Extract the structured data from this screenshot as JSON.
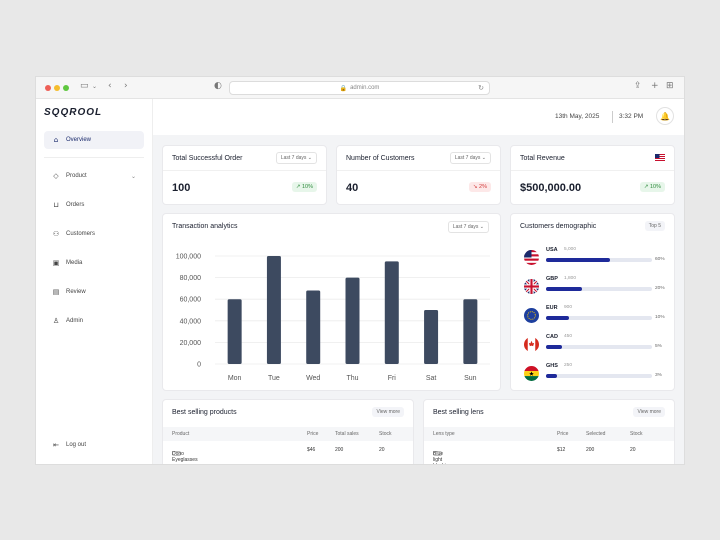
{
  "browser": {
    "url": "admin.com"
  },
  "brand": {
    "logo": "SQQROOL"
  },
  "sidebar": {
    "items": [
      {
        "label": "Overview",
        "icon": "home-icon"
      },
      {
        "label": "Product",
        "icon": "tag-icon"
      },
      {
        "label": "Orders",
        "icon": "basket-icon"
      },
      {
        "label": "Customers",
        "icon": "users-icon"
      },
      {
        "label": "Media",
        "icon": "image-icon"
      },
      {
        "label": "Review",
        "icon": "review-icon"
      },
      {
        "label": "Admin",
        "icon": "user-icon"
      }
    ],
    "logout": "Log out"
  },
  "header": {
    "date": "13th May, 2025",
    "time": "3:32 PM"
  },
  "kpis": [
    {
      "title": "Total Successful Order",
      "filter": "Last 7 days",
      "value": "100",
      "change": "10%",
      "trend": "up"
    },
    {
      "title": "Number of Customers",
      "filter": "Last 7 days",
      "value": "40",
      "change": "2%",
      "trend": "down"
    },
    {
      "title": "Total Revenue",
      "value": "$500,000.00",
      "change": "10%",
      "trend": "up"
    }
  ],
  "analytics": {
    "title": "Transaction analytics",
    "filter": "Last 7 days"
  },
  "chart_data": {
    "type": "bar",
    "title": "Transaction analytics",
    "categories": [
      "Mon",
      "Tue",
      "Wed",
      "Thu",
      "Fri",
      "Sat",
      "Sun"
    ],
    "values": [
      60000,
      100000,
      68000,
      80000,
      95000,
      50000,
      60000
    ],
    "yticks": [
      "0",
      "20,000",
      "40,000",
      "60,000",
      "80,000",
      "100,000"
    ],
    "ylim": [
      0,
      100000
    ],
    "grid": true,
    "bar_color": "#3d4a60"
  },
  "demographic": {
    "title": "Customers demographic",
    "filter": "Top 5",
    "rows": [
      {
        "code": "USA",
        "count": "5,000",
        "pct": "60%",
        "fraction": 0.6
      },
      {
        "code": "GBP",
        "count": "1,800",
        "pct": "20%",
        "fraction": 0.34
      },
      {
        "code": "EUR",
        "count": "900",
        "pct": "10%",
        "fraction": 0.22
      },
      {
        "code": "CAD",
        "count": "450",
        "pct": "5%",
        "fraction": 0.15
      },
      {
        "code": "GHS",
        "count": "250",
        "pct": "3%",
        "fraction": 0.1
      }
    ]
  },
  "best_products": {
    "title": "Best selling products",
    "action": "View more",
    "columns": [
      "Product",
      "Price",
      "Total sales",
      "Stock"
    ],
    "rows": [
      [
        "Dono Eyeglasses",
        "$46",
        "200",
        "20"
      ]
    ]
  },
  "best_lens": {
    "title": "Best selling lens",
    "action": "View more",
    "columns": [
      "Lens type",
      "Price",
      "Selected",
      "Stock"
    ],
    "rows": [
      [
        "Blue light blocking",
        "$12",
        "200",
        "20"
      ]
    ]
  },
  "colors": {
    "accent": "#1e2a9a",
    "bar": "#3d4a60",
    "up": "#2e8b3d",
    "down": "#d23b3b"
  }
}
